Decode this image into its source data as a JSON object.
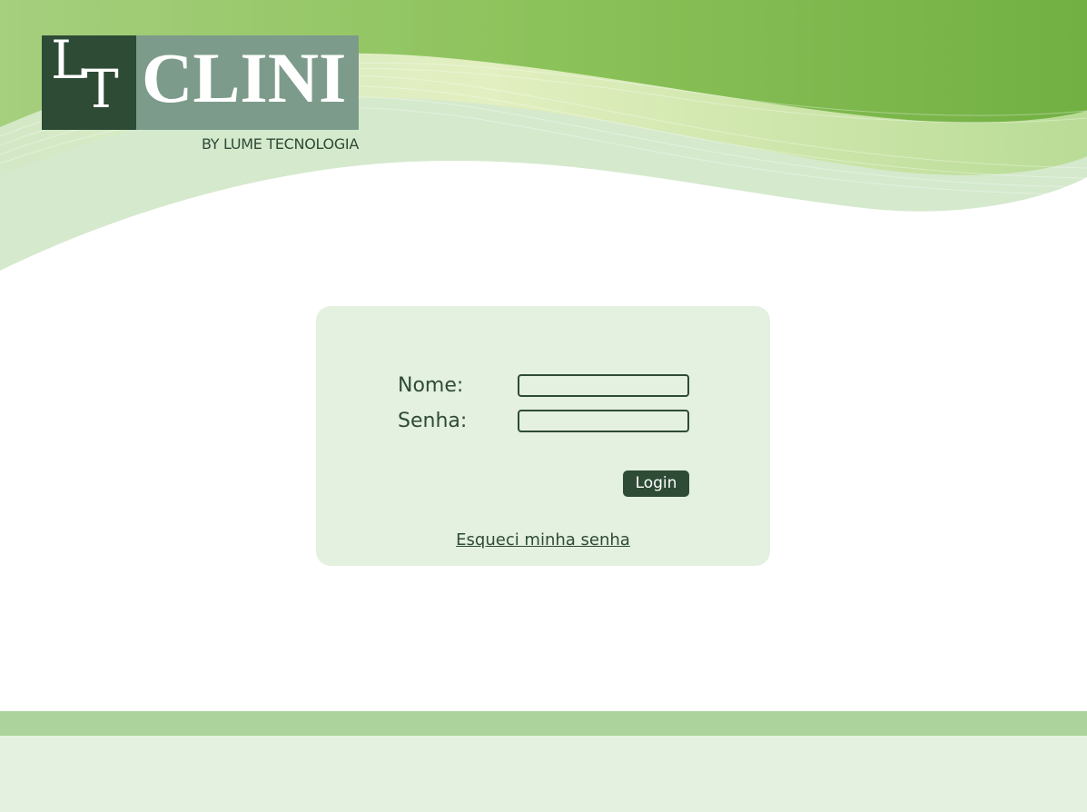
{
  "brand": {
    "logo_monogram_l": "L",
    "logo_monogram_t": "T",
    "logo_name": "CLINI",
    "byline": "BY LUME TECNOLOGIA"
  },
  "login_form": {
    "name_label": "Nome:",
    "name_value": "",
    "password_label": "Senha:",
    "password_value": "",
    "login_button_label": "Login",
    "forgot_password_link": "Esqueci minha senha"
  },
  "colors": {
    "primary_dark_green": "#2e4b36",
    "accent_green": "#7cb342",
    "card_background": "#e4f0e0",
    "footer_stripe": "#acd39b"
  }
}
